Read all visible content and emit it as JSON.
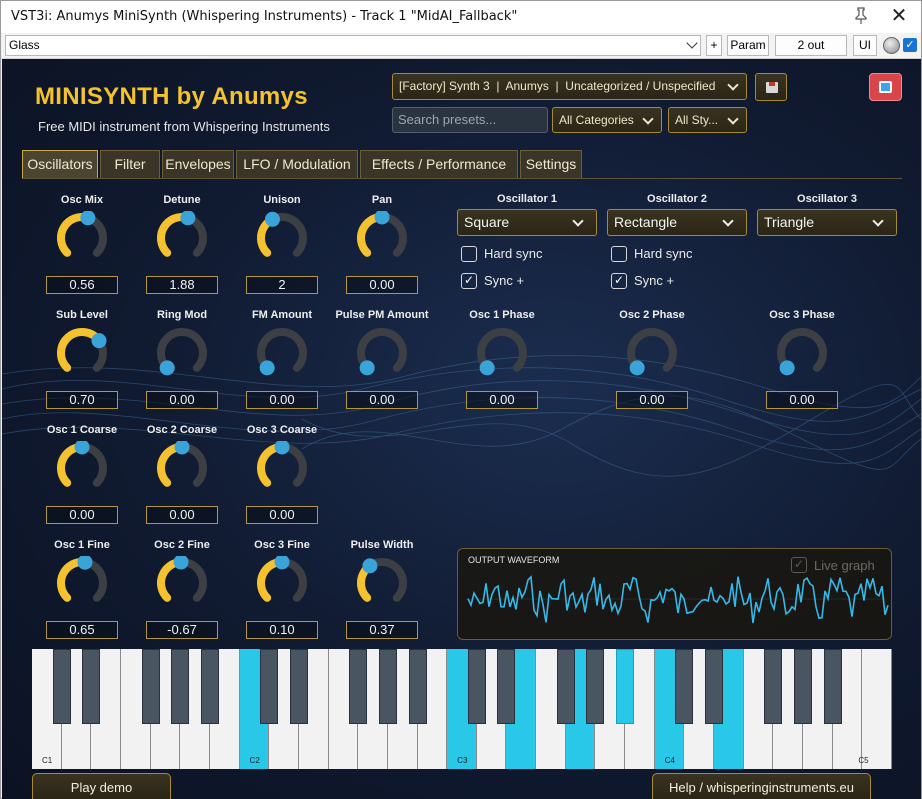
{
  "window": {
    "title": "VST3i: Anumys MiniSynth (Whispering Instruments) - Track 1 \"MidAI_Fallback\"",
    "close_glyph": "✕"
  },
  "toolbar": {
    "preset": "Glass",
    "plus_label": "+",
    "param_label": "Param",
    "out_label": "2 out",
    "ui_label": "UI"
  },
  "header": {
    "brand": "MINISYNTH by Anumys",
    "tagline": "Free MIDI instrument from Whispering Instruments",
    "preset_selector": "[Factory] Synth 3  |  Anumys  |  Uncategorized / Unspecified",
    "search_placeholder": "Search presets...",
    "category_filter": "All Categories",
    "style_filter": "All Sty..."
  },
  "tabs": [
    {
      "label": "Oscillators",
      "active": true
    },
    {
      "label": "Filter",
      "active": false
    },
    {
      "label": "Envelopes",
      "active": false
    },
    {
      "label": "LFO / Modulation",
      "active": false
    },
    {
      "label": "Effects / Performance",
      "active": false
    },
    {
      "label": "Settings",
      "active": false
    }
  ],
  "knobs": [
    {
      "label": "Osc Mix",
      "value": "0.56",
      "level": 0.56
    },
    {
      "label": "Detune",
      "value": "1.88",
      "level": 0.56
    },
    {
      "label": "Unison",
      "value": "2",
      "level": 0.4
    },
    {
      "label": "Pan",
      "value": "0.00",
      "level": 0.5
    },
    {
      "label": "Sub Level",
      "value": "0.70",
      "level": 0.7
    },
    {
      "label": "Ring Mod",
      "value": "0.00",
      "level": 0.0
    },
    {
      "label": "FM Amount",
      "value": "0.00",
      "level": 0.0
    },
    {
      "label": "Pulse PM Amount",
      "value": "0.00",
      "level": 0.0
    },
    {
      "label": "Osc 1 Phase",
      "value": "0.00",
      "level": 0.0
    },
    {
      "label": "Osc 2 Phase",
      "value": "0.00",
      "level": 0.0
    },
    {
      "label": "Osc 3 Phase",
      "value": "0.00",
      "level": 0.0
    },
    {
      "label": "Osc 1 Coarse",
      "value": "0.00",
      "level": 0.5
    },
    {
      "label": "Osc 2 Coarse",
      "value": "0.00",
      "level": 0.5
    },
    {
      "label": "Osc 3 Coarse",
      "value": "0.00",
      "level": 0.5
    },
    {
      "label": "Osc 1 Fine",
      "value": "0.65",
      "level": 0.53
    },
    {
      "label": "Osc 2 Fine",
      "value": "-0.67",
      "level": 0.49
    },
    {
      "label": "Osc 3 Fine",
      "value": "0.10",
      "level": 0.5
    },
    {
      "label": "Pulse Width",
      "value": "0.37",
      "level": 0.37
    }
  ],
  "oscillators": [
    {
      "header": "Oscillator 1",
      "wave": "Square",
      "hard_sync_label": "Hard sync",
      "hard_sync": false,
      "sync_plus_label": "Sync +",
      "sync_plus": true
    },
    {
      "header": "Oscillator 2",
      "wave": "Rectangle",
      "hard_sync_label": "Hard sync",
      "hard_sync": false,
      "sync_plus_label": "Sync +",
      "sync_plus": true
    },
    {
      "header": "Oscillator 3",
      "wave": "Triangle"
    }
  ],
  "scope": {
    "label": "OUTPUT WAVEFORM",
    "live_label": "Live graph",
    "live_checked": true
  },
  "keyboard": {
    "octave_labels": [
      "C1",
      "C2",
      "C3",
      "C4",
      "C5"
    ]
  },
  "footer": {
    "play_demo": "Play demo",
    "help": "Help / whisperinginstruments.eu"
  },
  "colors": {
    "accent_yellow": "#f5c22f",
    "knob_dot": "#3aa3d8",
    "key_highlight": "#2ac8e8",
    "scope_line": "#36b8e8"
  }
}
